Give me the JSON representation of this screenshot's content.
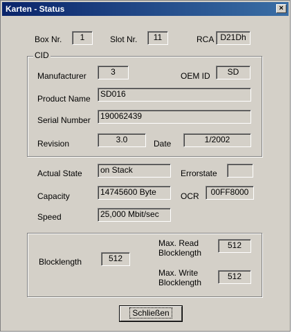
{
  "window": {
    "title": "Karten - Status",
    "close_symbol": "×"
  },
  "top": {
    "box_label": "Box Nr.",
    "box_value": "1",
    "slot_label": "Slot Nr.",
    "slot_value": "11",
    "rca_label": "RCA",
    "rca_value": "D21Dh"
  },
  "cid": {
    "legend": "CID",
    "manufacturer_label": "Manufacturer",
    "manufacturer_value": "3",
    "oem_label": "OEM ID",
    "oem_value": "SD",
    "product_label": "Product Name",
    "product_value": "SD016",
    "serial_label": "Serial Number",
    "serial_value": "190062439",
    "revision_label": "Revision",
    "revision_value": "3.0",
    "date_label": "Date",
    "date_value": "1/2002"
  },
  "state": {
    "actual_label": "Actual State",
    "actual_value": "on Stack",
    "error_label": "Errorstate",
    "error_value": "",
    "capacity_label": "Capacity",
    "capacity_value": "14745600 Byte",
    "ocr_label": "OCR",
    "ocr_value": "00FF8000",
    "speed_label": "Speed",
    "speed_value": "25,000 Mbit/sec"
  },
  "block": {
    "blocklength_label": "Blocklength",
    "blocklength_value": "512",
    "maxread_label_line1": "Max. Read",
    "maxread_label_line2": "Blocklength",
    "maxread_value": "512",
    "maxwrite_label_line1": "Max. Write",
    "maxwrite_label_line2": "Blocklength",
    "maxwrite_value": "512"
  },
  "close_button": {
    "label": "Schließen"
  }
}
